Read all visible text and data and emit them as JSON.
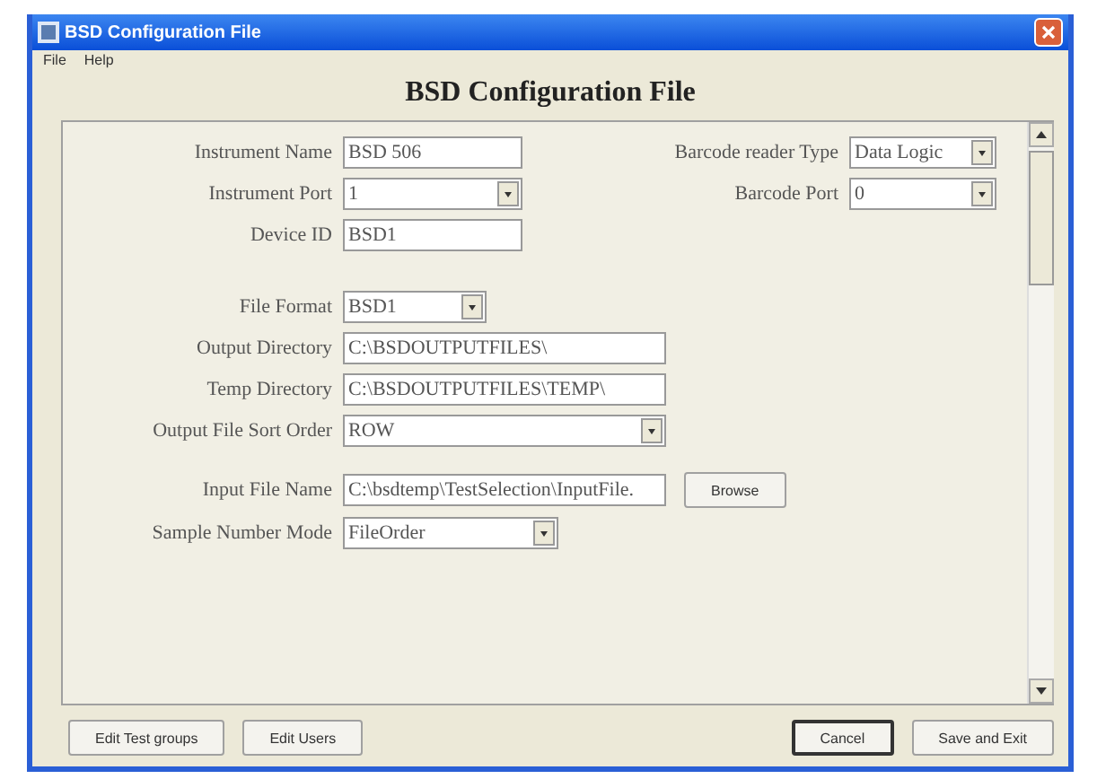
{
  "window": {
    "title": "BSD Configuration File"
  },
  "menu": [
    "File",
    "Help"
  ],
  "heading": "BSD Configuration File",
  "left_fields": [
    {
      "kind": "text",
      "label": "Instrument Name",
      "value": "BSD 506"
    },
    {
      "kind": "dropdown",
      "label": "Instrument Port",
      "value": "1"
    },
    {
      "kind": "text",
      "label": "Device ID",
      "value": "BSD1"
    }
  ],
  "right_fields": [
    {
      "kind": "dropdown",
      "label": "Barcode reader Type",
      "value": "Data Logic"
    },
    {
      "kind": "dropdown",
      "label": "Barcode Port",
      "value": "0"
    }
  ],
  "file_fields": [
    {
      "kind": "dropdown",
      "label": "File Format",
      "value": "BSD1"
    },
    {
      "kind": "text",
      "label": "Output Directory",
      "value": "C:\\BSDOUTPUTFILES\\"
    },
    {
      "kind": "text",
      "label": "Temp Directory",
      "value": "C:\\BSDOUTPUTFILES\\TEMP\\"
    },
    {
      "kind": "dropdown",
      "label": "Output File Sort Order",
      "value": "ROW"
    }
  ],
  "input_fields": [
    {
      "kind": "browse",
      "label": "Input File Name",
      "value": "C:\\bsdtemp\\TestSelection\\InputFile.",
      "button": "Browse"
    },
    {
      "kind": "dropdown",
      "label": "Sample Number Mode",
      "value": "FileOrder"
    }
  ],
  "buttons_left": [
    "Edit Test groups",
    "Edit Users"
  ],
  "buttons_right": [
    {
      "label": "Cancel",
      "default": true
    },
    {
      "label": "Save and Exit",
      "default": false
    }
  ]
}
